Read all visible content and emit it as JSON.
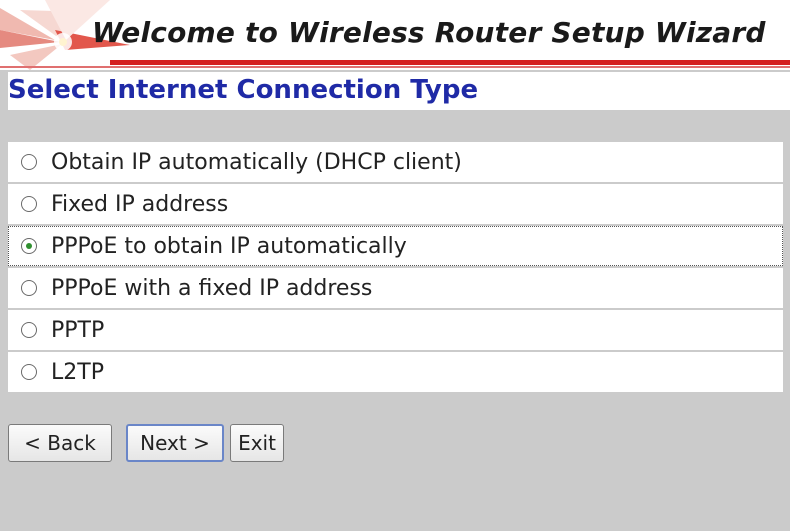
{
  "banner": {
    "title": "Welcome to Wireless Router Setup Wizard"
  },
  "section": {
    "title": "Select Internet Connection Type"
  },
  "options": [
    {
      "label": "Obtain IP automatically (DHCP client)",
      "selected": false
    },
    {
      "label": "Fixed IP address",
      "selected": false
    },
    {
      "label": "PPPoE to obtain IP automatically",
      "selected": true
    },
    {
      "label": "PPPoE with a fixed IP address",
      "selected": false
    },
    {
      "label": "PPTP",
      "selected": false
    },
    {
      "label": "L2TP",
      "selected": false
    }
  ],
  "buttons": {
    "back": "< Back",
    "next": "Next >",
    "exit": "Exit"
  },
  "colors": {
    "heading": "#1f2aa6",
    "accent_line": "#d41f1f",
    "panel_background": "#cbcbcb",
    "radio_dot": "#2f8f2f"
  }
}
